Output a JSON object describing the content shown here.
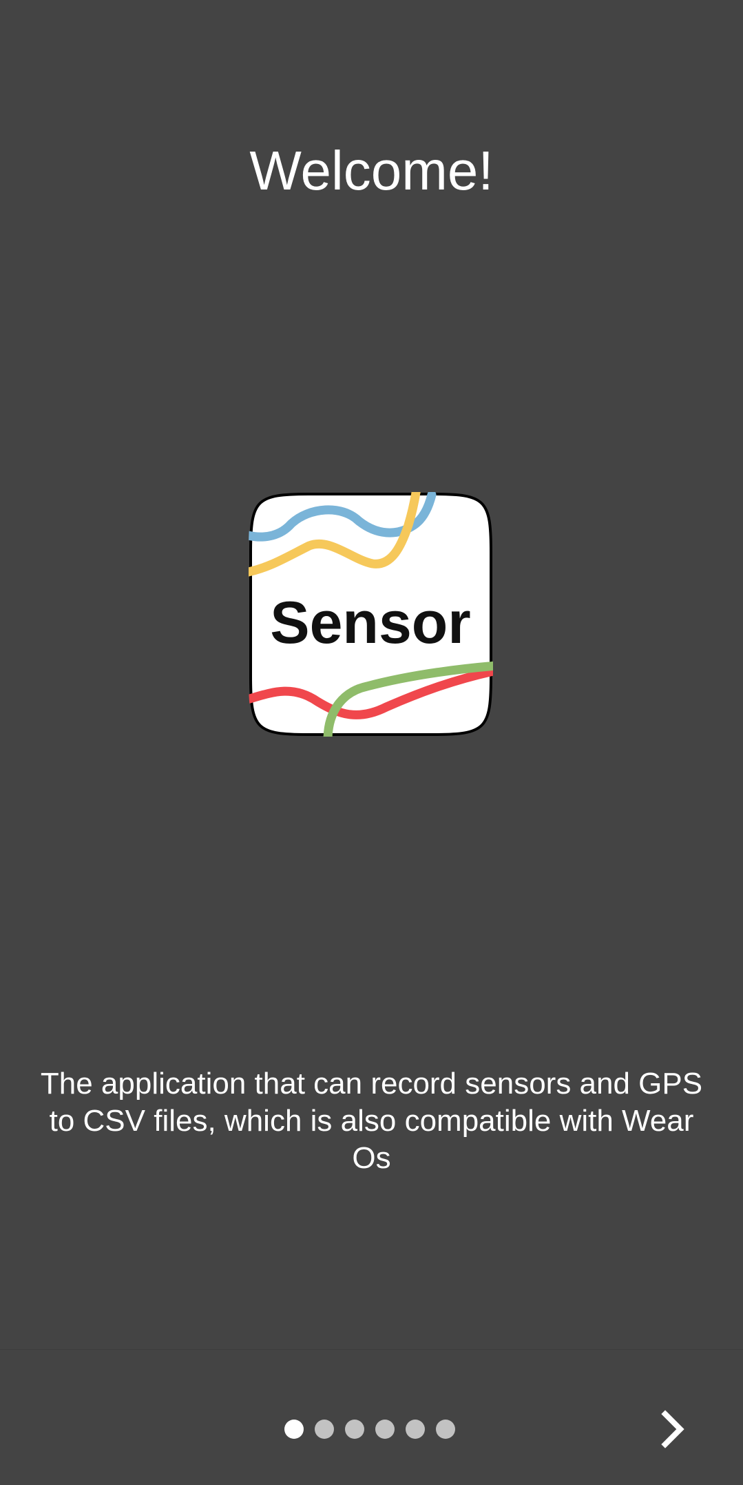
{
  "onboarding": {
    "title": "Welcome!",
    "logo_text": "Sensor",
    "description": "The application that can record sensors and GPS to CSV files, which is also compatible with Wear Os"
  },
  "pager": {
    "page_count": 6,
    "current_page": 1,
    "next_icon": "chevron-right-icon"
  },
  "colors": {
    "background": "#444444",
    "text": "#ffffff",
    "dot_active": "#ffffff",
    "dot_inactive": "#c2c2c2",
    "logo_blue": "#7ab4d8",
    "logo_yellow": "#f6c85a",
    "logo_green": "#8fbc6a",
    "logo_red": "#f0474c"
  }
}
